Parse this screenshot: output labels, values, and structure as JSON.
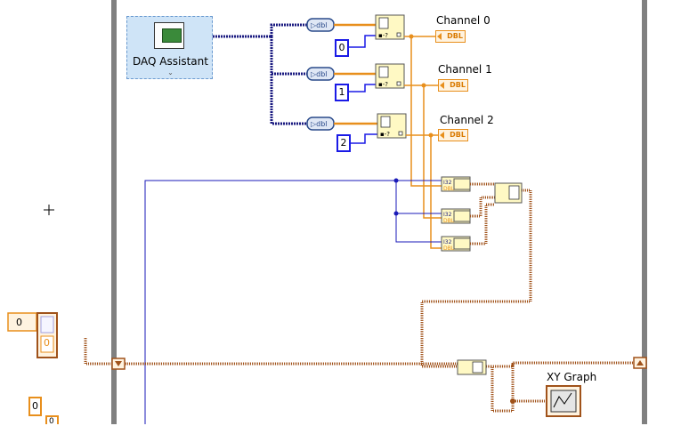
{
  "daq": {
    "label": "DAQ Assistant"
  },
  "channels": [
    {
      "index": "0",
      "label": "Channel 0",
      "indicator": "DBL"
    },
    {
      "index": "1",
      "label": "Channel 1",
      "indicator": "DBL"
    },
    {
      "index": "2",
      "label": "Channel 2",
      "indicator": "DBL"
    }
  ],
  "left_controls": {
    "numeric": "0",
    "array_index": "0",
    "bottom_value": "0",
    "bottom_value2": "0"
  },
  "graph": {
    "label": "XY Graph"
  },
  "colors": {
    "dynamic_wire": "#1a1a80",
    "double_wire": "#e88f1c",
    "cluster_wire": "#a0521a",
    "loop_border": "#808080"
  }
}
